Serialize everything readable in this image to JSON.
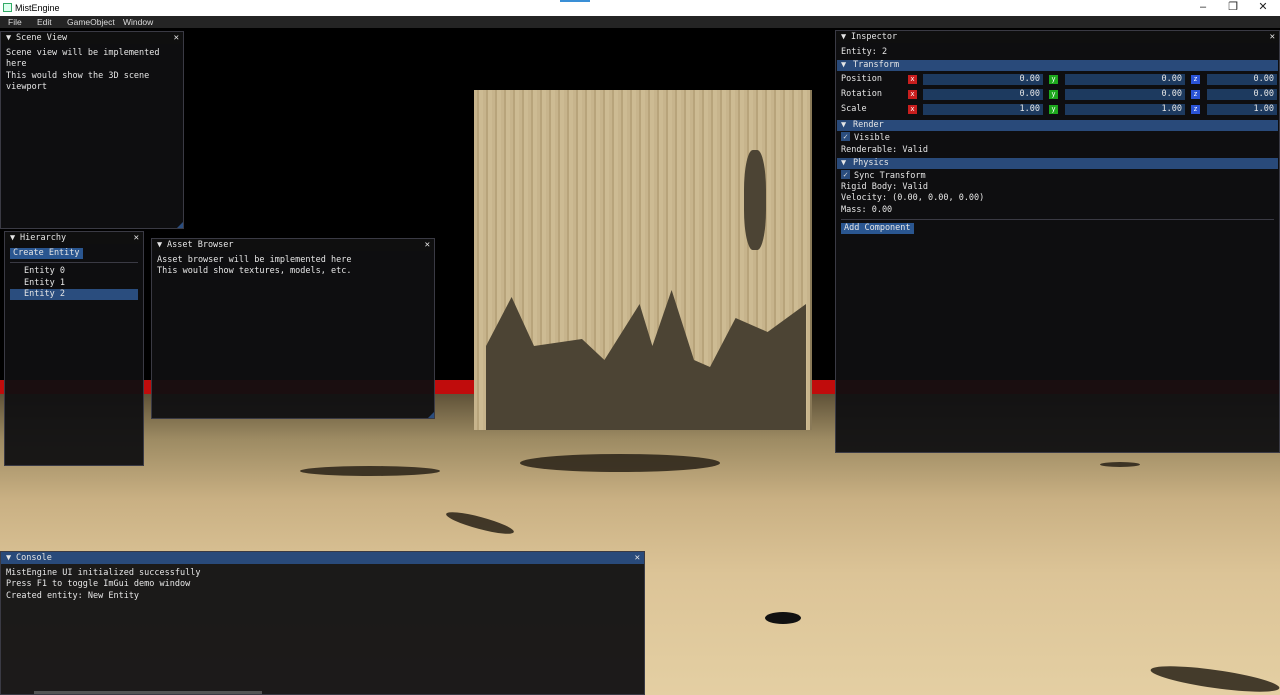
{
  "os": {
    "title": "MistEngine",
    "minimize": "–",
    "maximize": "❐",
    "close": "✕"
  },
  "menu": [
    "File",
    "Edit",
    "GameObject",
    "Window"
  ],
  "scene_view": {
    "title": "Scene View",
    "lines": [
      "Scene view will be implemented here",
      "This would show the 3D scene viewport"
    ]
  },
  "hierarchy": {
    "title": "Hierarchy",
    "create_button": "Create Entity",
    "items": [
      "Entity 0",
      "Entity 1",
      "Entity 2"
    ],
    "selected_index": 2
  },
  "asset_browser": {
    "title": "Asset Browser",
    "lines": [
      "Asset browser will be implemented here",
      "This would show textures, models, etc."
    ]
  },
  "inspector": {
    "title": "Inspector",
    "entity_label": "Entity: 2",
    "transform": {
      "header": "Transform",
      "rows": [
        {
          "label": "Position",
          "x": "0.00",
          "y": "0.00",
          "z": "0.00"
        },
        {
          "label": "Rotation",
          "x": "0.00",
          "y": "0.00",
          "z": "0.00"
        },
        {
          "label": "Scale",
          "x": "1.00",
          "y": "1.00",
          "z": "1.00"
        }
      ],
      "axis_x": "x",
      "axis_y": "y",
      "axis_z": "z"
    },
    "render": {
      "header": "Render",
      "visible_label": "Visible",
      "visible": true,
      "renderable": "Renderable: Valid"
    },
    "physics": {
      "header": "Physics",
      "sync_label": "Sync Transform",
      "sync": true,
      "rigid_body": "Rigid Body: Valid",
      "velocity": "Velocity: (0.00, 0.00, 0.00)",
      "mass": "Mass: 0.00"
    },
    "add_component": "Add Component"
  },
  "console": {
    "title": "Console",
    "lines": [
      "MistEngine UI initialized successfully",
      "Press F1 to toggle ImGui demo window",
      "Created entity: New Entity"
    ]
  },
  "glyphs": {
    "collapse_arrow": "▼",
    "close": "✕",
    "check": "✓"
  },
  "colors": {
    "accent": "#294a7a",
    "axis_x": "#c81e1e",
    "axis_y": "#1da81d",
    "axis_z": "#2a53d6",
    "ground_line": "#c00c0c"
  }
}
